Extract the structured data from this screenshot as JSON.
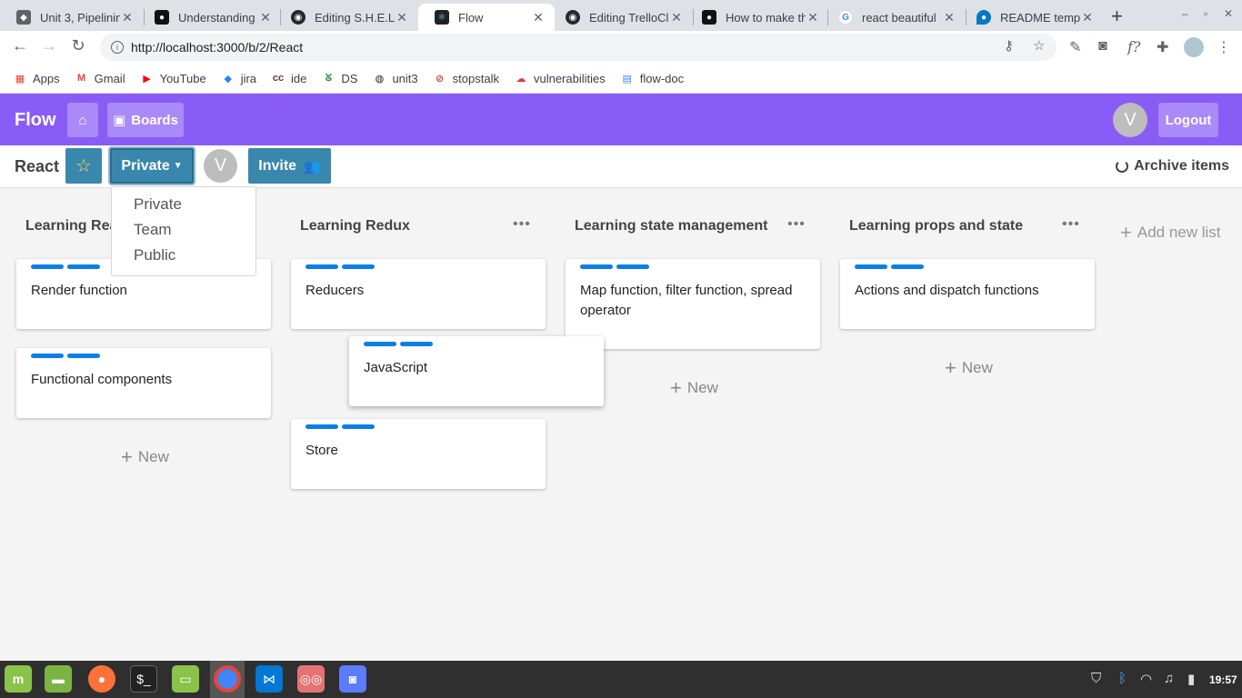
{
  "browser": {
    "tabs": [
      {
        "title": "Unit 3, Pipelinin",
        "icon": "graduation-icon"
      },
      {
        "title": "Understanding",
        "icon": "medium-icon"
      },
      {
        "title": "Editing S.H.E.L.",
        "icon": "github-icon"
      },
      {
        "title": "Flow",
        "icon": "react-icon"
      },
      {
        "title": "Editing TrelloCl",
        "icon": "github-icon"
      },
      {
        "title": "How to make th",
        "icon": "medium-icon"
      },
      {
        "title": "react beautiful",
        "icon": "google-icon"
      },
      {
        "title": "README templ",
        "icon": "drupal-icon"
      }
    ],
    "url": "http://localhost:3000/b/2/React",
    "bookmarks": [
      {
        "label": "Apps",
        "icon": "apps-grid-icon",
        "color": "#e94235"
      },
      {
        "label": "Gmail",
        "icon": "gmail-icon",
        "color": "#ea4335"
      },
      {
        "label": "YouTube",
        "icon": "youtube-icon",
        "color": "#ff0000"
      },
      {
        "label": "jira",
        "icon": "jira-icon",
        "color": "#2684ff"
      },
      {
        "label": "ide",
        "icon": "ide-icon",
        "color": "#5d4037"
      },
      {
        "label": "DS",
        "icon": "geeks-icon",
        "color": "#2f8d46"
      },
      {
        "label": "unit3",
        "icon": "globe-icon",
        "color": "#202124"
      },
      {
        "label": "stopstalk",
        "icon": "stopstalk-icon",
        "color": "#e53935"
      },
      {
        "label": "vulnerabilities",
        "icon": "cloud-icon",
        "color": "#e53935"
      },
      {
        "label": "flow-doc",
        "icon": "doc-icon",
        "color": "#4285f4"
      }
    ]
  },
  "app": {
    "brand": "Flow",
    "boards_label": "Boards",
    "user_initial": "V",
    "logout_label": "Logout",
    "accent": "#8a5cf6"
  },
  "board": {
    "title": "React",
    "visibility_label": "Private",
    "invite_label": "Invite",
    "member_initial": "V",
    "archive_label": "Archive items",
    "visibility_options": [
      "Private",
      "Team",
      "Public"
    ]
  },
  "lists": [
    {
      "title": "Learning Rea",
      "cards": [
        "Render function",
        "Functional components"
      ],
      "new_label": "New"
    },
    {
      "title": "Learning Redux",
      "cards": [
        "Reducers",
        "Store"
      ],
      "dragging_card": "JavaScript"
    },
    {
      "title": "Learning state management",
      "cards": [
        "Map function, filter function, spread operator"
      ],
      "new_label": "New"
    },
    {
      "title": "Learning props and state",
      "cards": [
        "Actions and dispatch functions"
      ],
      "new_label": "New"
    }
  ],
  "add_list_label": "Add new list",
  "taskbar": {
    "clock": "19:57"
  }
}
